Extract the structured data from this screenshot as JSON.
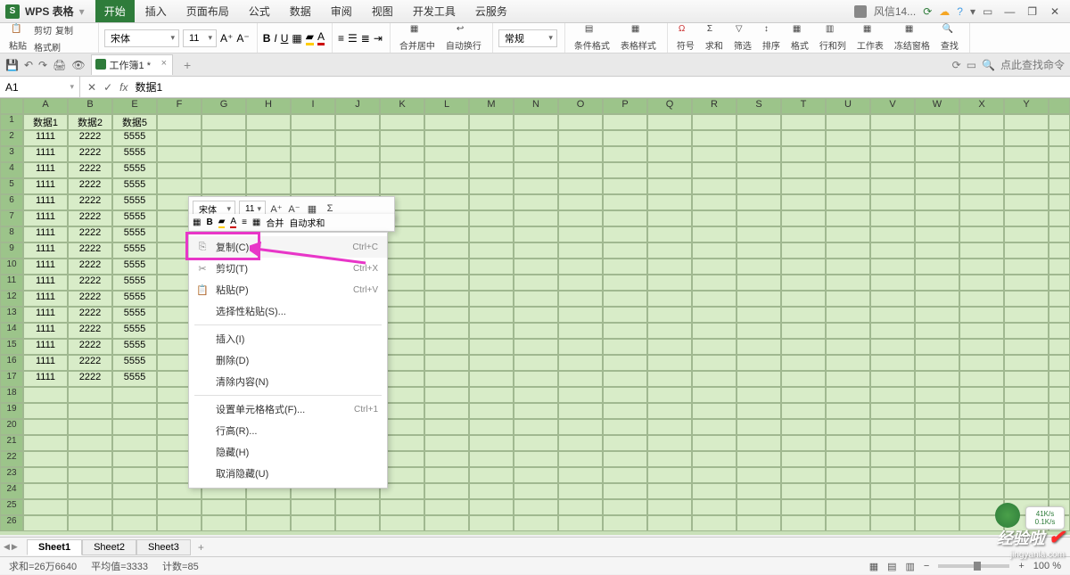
{
  "app": {
    "name": "WPS 表格",
    "user": "风信14...",
    "sync_icon": "sync"
  },
  "main_tabs": [
    "开始",
    "插入",
    "页面布局",
    "公式",
    "数据",
    "审阅",
    "视图",
    "开发工具",
    "云服务"
  ],
  "main_tab_active": 0,
  "ribbon": {
    "paste": "粘贴",
    "cut": "剪切",
    "copy": "复制",
    "format_painter": "格式刷",
    "font": "宋体",
    "font_size": "11",
    "merge": "合并居中",
    "wrap": "自动换行",
    "number_format": "常规",
    "cond_fmt": "条件格式",
    "table_style": "表格样式",
    "symbol": "符号",
    "sum": "求和",
    "filter": "筛选",
    "sort": "排序",
    "format": "格式",
    "row_col": "行和列",
    "worksheet": "工作表",
    "freeze": "冻结窗格",
    "find": "查找"
  },
  "doc_tab": {
    "name": "工作簿1 *"
  },
  "search_placeholder": "点此查找命令",
  "name_box": "A1",
  "formula_value": "数据1",
  "columns": [
    "A",
    "B",
    "E",
    "F",
    "G",
    "H",
    "I",
    "J",
    "K",
    "L",
    "M",
    "N",
    "O",
    "P",
    "Q",
    "R",
    "S",
    "T",
    "U",
    "V",
    "W",
    "X",
    "Y"
  ],
  "headers": {
    "A": "数据1",
    "B": "数据2",
    "E": "数据5"
  },
  "data_rows": 16,
  "values": {
    "A": "1111",
    "B": "2222",
    "E": "5555"
  },
  "visible_rows": 26,
  "mini_toolbar": {
    "font": "宋体",
    "size": "11",
    "merge": "合并",
    "autosum": "自动求和"
  },
  "context_menu": [
    {
      "icon": "⎘",
      "label": "复制(C)",
      "shortcut": "Ctrl+C",
      "hl": true
    },
    {
      "icon": "✂",
      "label": "剪切(T)",
      "shortcut": "Ctrl+X"
    },
    {
      "icon": "📋",
      "label": "粘贴(P)",
      "shortcut": "Ctrl+V"
    },
    {
      "icon": "",
      "label": "选择性粘贴(S)...",
      "shortcut": ""
    },
    {
      "sep": true
    },
    {
      "icon": "",
      "label": "插入(I)",
      "shortcut": ""
    },
    {
      "icon": "",
      "label": "删除(D)",
      "shortcut": ""
    },
    {
      "icon": "",
      "label": "清除内容(N)",
      "shortcut": ""
    },
    {
      "sep": true
    },
    {
      "icon": "",
      "label": "设置单元格格式(F)...",
      "shortcut": "Ctrl+1"
    },
    {
      "icon": "",
      "label": "行高(R)...",
      "shortcut": ""
    },
    {
      "icon": "",
      "label": "隐藏(H)",
      "shortcut": ""
    },
    {
      "icon": "",
      "label": "取消隐藏(U)",
      "shortcut": ""
    }
  ],
  "sheets": [
    "Sheet1",
    "Sheet2",
    "Sheet3"
  ],
  "active_sheet": 0,
  "status": {
    "sum": "求和=26万6640",
    "avg": "平均值=3333",
    "count": "计数=85",
    "zoom": "100 %"
  },
  "watermark": {
    "text1": "经验啦",
    "url": "jingyanla.com"
  },
  "net": {
    "up": "41K/s",
    "down": "0.1K/s"
  }
}
